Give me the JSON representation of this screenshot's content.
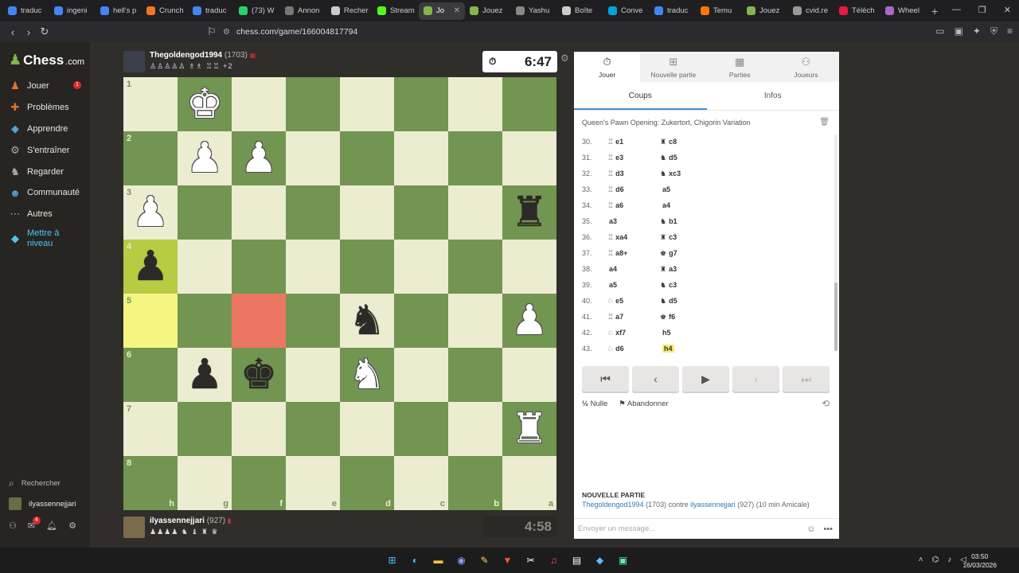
{
  "browser": {
    "tabs": [
      {
        "label": "traduc",
        "color": "#4285f4"
      },
      {
        "label": "ingeni",
        "color": "#4285f4"
      },
      {
        "label": "hell's p",
        "color": "#4285f4"
      },
      {
        "label": "Crunch",
        "color": "#f47521"
      },
      {
        "label": "traduc",
        "color": "#4285f4"
      },
      {
        "label": "(73) W",
        "color": "#25d366"
      },
      {
        "label": "Annon",
        "color": "#777777"
      },
      {
        "label": "Recher",
        "color": "#cccccc"
      },
      {
        "label": "Stream",
        "color": "#53fc18"
      },
      {
        "label": "Jo",
        "color": "#81b64c"
      },
      {
        "label": "Jouez",
        "color": "#81b64c"
      },
      {
        "label": "Yashu",
        "color": "#888888"
      },
      {
        "label": "Boîte",
        "color": "#cccccc"
      },
      {
        "label": "Conve",
        "color": "#00a3e0"
      },
      {
        "label": "traduc",
        "color": "#4285f4"
      },
      {
        "label": "Temu",
        "color": "#fb7701"
      },
      {
        "label": "Jouez",
        "color": "#81b64c"
      },
      {
        "label": "cvid.re",
        "color": "#999999"
      },
      {
        "label": "Téléch",
        "color": "#e31c3d"
      },
      {
        "label": "Wheel",
        "color": "#aa66cc"
      }
    ],
    "active_tab": 9,
    "url": "chess.com/game/166004817794"
  },
  "sidebar": {
    "logo": "Chess",
    "logo_suffix": ".com",
    "items": [
      {
        "label": "Jouer",
        "icon": "pawn-icon",
        "color": "#e0742c"
      },
      {
        "label": "Problèmes",
        "icon": "puzzle-icon",
        "color": "#e0742c"
      },
      {
        "label": "Apprendre",
        "icon": "learn-icon",
        "color": "#4aa3df"
      },
      {
        "label": "S'entraîner",
        "icon": "train-icon",
        "color": "#aaaaaa"
      },
      {
        "label": "Regarder",
        "icon": "watch-icon",
        "color": "#aaaaaa"
      },
      {
        "label": "Communauté",
        "icon": "community-icon",
        "color": "#4aa3df"
      },
      {
        "label": "Autres",
        "icon": "more-icon",
        "color": "#aaaaaa"
      },
      {
        "label": "Mettre à niveau",
        "icon": "diamond-icon",
        "color": "#4fc3f7"
      }
    ],
    "jouer_badge": "1",
    "search_label": "Rechercher",
    "username": "ilyassennejjari",
    "mail_badge": "4"
  },
  "top_player": {
    "name": "Thegoldengod1994",
    "rating": "(1703)",
    "captured": "♙♙♙♙♙ ♗♗ ♖♖ +2",
    "clock": "6:47"
  },
  "bottom_player": {
    "name": "ilyassennejjari",
    "rating": "(927)",
    "captured": "♟♟♟♟ ♞ ♝ ♜ ♛",
    "clock": "4:58"
  },
  "board": {
    "ranks": [
      "1",
      "2",
      "3",
      "4",
      "5",
      "6",
      "7",
      "8"
    ],
    "files": [
      "h",
      "g",
      "f",
      "e",
      "d",
      "c",
      "b",
      "a"
    ],
    "pieces": [
      {
        "row": 0,
        "col": 1,
        "glyph": "♚",
        "color": "white",
        "name": "white-king"
      },
      {
        "row": 1,
        "col": 1,
        "glyph": "♟",
        "color": "white",
        "name": "white-pawn"
      },
      {
        "row": 1,
        "col": 2,
        "glyph": "♟",
        "color": "white",
        "name": "white-pawn"
      },
      {
        "row": 2,
        "col": 0,
        "glyph": "♟",
        "color": "white",
        "name": "white-pawn"
      },
      {
        "row": 2,
        "col": 7,
        "glyph": "♜",
        "color": "black",
        "name": "black-rook"
      },
      {
        "row": 3,
        "col": 0,
        "glyph": "♟",
        "color": "black",
        "name": "black-pawn"
      },
      {
        "row": 4,
        "col": 4,
        "glyph": "♞",
        "color": "black",
        "name": "black-knight"
      },
      {
        "row": 4,
        "col": 7,
        "glyph": "♟",
        "color": "white",
        "name": "white-pawn"
      },
      {
        "row": 5,
        "col": 1,
        "glyph": "♟",
        "color": "black",
        "name": "black-pawn"
      },
      {
        "row": 5,
        "col": 2,
        "glyph": "♚",
        "color": "black",
        "name": "black-king"
      },
      {
        "row": 5,
        "col": 4,
        "glyph": "♞",
        "color": "white",
        "name": "white-knight"
      },
      {
        "row": 6,
        "col": 7,
        "glyph": "♜",
        "color": "white",
        "name": "white-rook"
      }
    ],
    "highlights": [
      {
        "row": 3,
        "col": 0,
        "type": "last-move"
      },
      {
        "row": 4,
        "col": 0,
        "type": "last-move"
      },
      {
        "row": 4,
        "col": 2,
        "type": "marked"
      }
    ]
  },
  "panel": {
    "tabs": [
      {
        "label": "Jouer",
        "icon": "stopwatch-icon"
      },
      {
        "label": "Nouvelle partie",
        "icon": "plus-icon"
      },
      {
        "label": "Parties",
        "icon": "board-icon"
      },
      {
        "label": "Joueurs",
        "icon": "players-icon"
      }
    ],
    "subtabs": [
      "Coups",
      "Infos"
    ],
    "opening": "Queen's Pawn Opening: Zukertort, Chigorin Variation",
    "moves": [
      {
        "num": "30.",
        "w_icon": "♖",
        "w": "e1",
        "b_icon": "♜",
        "b": "c8"
      },
      {
        "num": "31.",
        "w_icon": "♖",
        "w": "e3",
        "b_icon": "♞",
        "b": "d5"
      },
      {
        "num": "32.",
        "w_icon": "♖",
        "w": "d3",
        "b_icon": "♞",
        "b": "xc3"
      },
      {
        "num": "33.",
        "w_icon": "♖",
        "w": "d6",
        "b_icon": "",
        "b": "a5"
      },
      {
        "num": "34.",
        "w_icon": "♖",
        "w": "a6",
        "b_icon": "",
        "b": "a4"
      },
      {
        "num": "35.",
        "w_icon": "",
        "w": "a3",
        "b_icon": "♞",
        "b": "b1"
      },
      {
        "num": "36.",
        "w_icon": "♖",
        "w": "xa4",
        "b_icon": "♜",
        "b": "c3"
      },
      {
        "num": "37.",
        "w_icon": "♖",
        "w": "a8+",
        "b_icon": "♚",
        "b": "g7"
      },
      {
        "num": "38.",
        "w_icon": "",
        "w": "a4",
        "b_icon": "♜",
        "b": "a3"
      },
      {
        "num": "39.",
        "w_icon": "",
        "w": "a5",
        "b_icon": "♞",
        "b": "c3"
      },
      {
        "num": "40.",
        "w_icon": "♘",
        "w": "e5",
        "b_icon": "♞",
        "b": "d5"
      },
      {
        "num": "41.",
        "w_icon": "♖",
        "w": "a7",
        "b_icon": "♚",
        "b": "f6"
      },
      {
        "num": "42.",
        "w_icon": "♘",
        "w": "xf7",
        "b_icon": "",
        "b": "h5"
      },
      {
        "num": "43.",
        "w_icon": "♘",
        "w": "d6",
        "b_icon": "",
        "b": "h4"
      }
    ],
    "draw_label": "Nulle",
    "draw_icon": "½",
    "resign_label": "Abandonner",
    "new_game_title": "NOUVELLE PARTIE",
    "new_game_player1": "Thegoldengod1994",
    "new_game_rating1": "(1703)",
    "new_game_contre": "contre",
    "new_game_player2": "ilyassennejjari",
    "new_game_rating2": "(927)",
    "new_game_mode": "(10 min Amicale)",
    "chat_placeholder": "Envoyer un message..."
  },
  "taskbar": {
    "time": "03:50",
    "date": "16/03/2026"
  }
}
